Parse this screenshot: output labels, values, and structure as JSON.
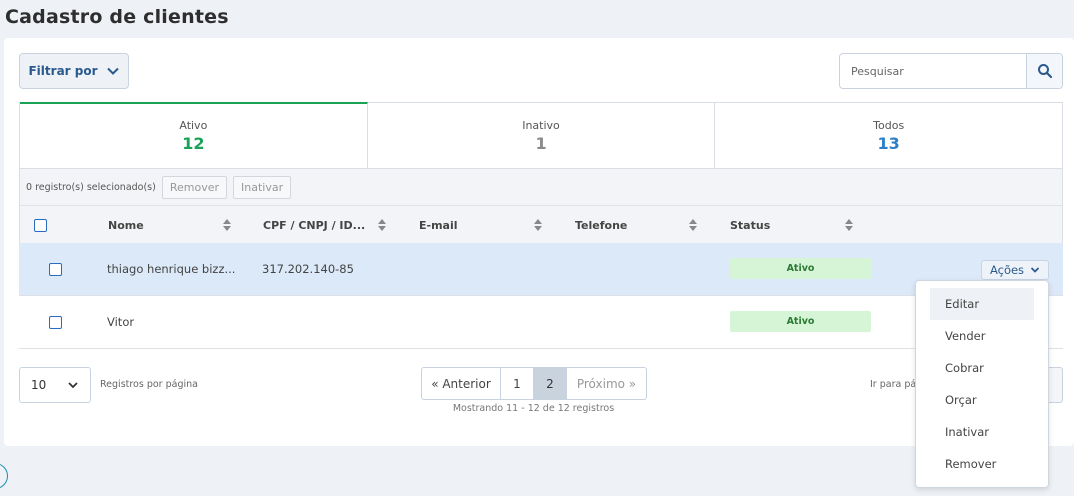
{
  "page_title": "Cadastro de clientes",
  "filter": {
    "label": "Filtrar por"
  },
  "search": {
    "placeholder": "Pesquisar"
  },
  "tabs": [
    {
      "label": "Ativo",
      "count": "12",
      "color": "#1aa355"
    },
    {
      "label": "Inativo",
      "count": "1",
      "color": "#8a8a8a"
    },
    {
      "label": "Todos",
      "count": "13",
      "color": "#2d7fc6"
    }
  ],
  "selection": {
    "text": "0 registro(s) selecionado(s)",
    "remove_label": "Remover",
    "deactivate_label": "Inativar"
  },
  "columns": [
    "Nome",
    "CPF / CNPJ / ID...",
    "E-mail",
    "Telefone",
    "Status"
  ],
  "rows": [
    {
      "name": "thiago henrique bizz...",
      "doc": "317.202.140-85",
      "email": "",
      "phone": "",
      "status": "Ativo",
      "actions_label": "Ações"
    },
    {
      "name": "Vitor",
      "doc": "",
      "email": "",
      "phone": "",
      "status": "Ativo"
    }
  ],
  "actions_menu": [
    "Editar",
    "Vender",
    "Cobrar",
    "Orçar",
    "Inativar",
    "Remover"
  ],
  "pagination": {
    "per_page_value": "10",
    "per_page_label": "Registros por página",
    "prev_label": "« Anterior",
    "pages": [
      "1",
      "2"
    ],
    "current_page": "2",
    "next_label": "Próximo »",
    "info": "Mostrando 11 - 12 de 12 registros",
    "goto_label": "Ir para pá"
  },
  "colors": {
    "accent": "#2a5a8c",
    "active_green": "#1aa355",
    "status_bg": "#d6f5d6",
    "selected_row": "#dce9f8"
  }
}
